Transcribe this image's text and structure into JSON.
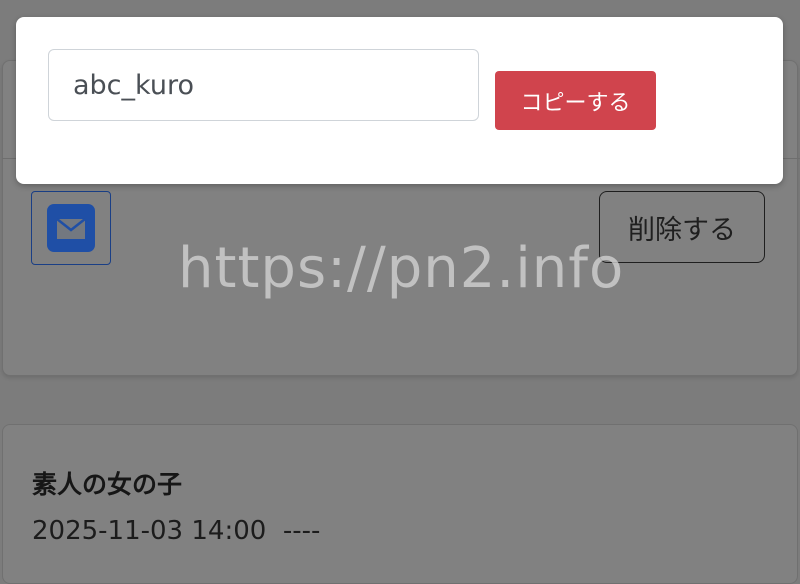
{
  "modal": {
    "input_value": "abc_kuro",
    "copy_label": "コピーする"
  },
  "post_card": {
    "delete_label": "削除する",
    "mail_icon": "mail-icon"
  },
  "next_card": {
    "title": "素人の女の子",
    "datetime": "2025-11-03 14:00  ----"
  },
  "watermark": "https://pn2.info",
  "colors": {
    "copy_button": "#d0444d",
    "mail_icon": "#1f4fa6",
    "overlay": "#7c7c7c"
  }
}
